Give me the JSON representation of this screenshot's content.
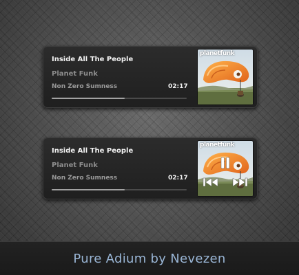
{
  "colors": {
    "panel": "#262626",
    "title_text": "#f2f2f2",
    "secondary_text": "#8d8d8d",
    "progress_fill": "#a3a3a3",
    "footer_text": "#9ab6d6"
  },
  "players": [
    {
      "track_title": "Inside All The People",
      "artist": "Planet Funk",
      "album": "Non Zero Sumness",
      "time": "02:17",
      "progress": 0.54,
      "cover_brand": "planetfunk",
      "controls_visible": false
    },
    {
      "track_title": "Inside All The People",
      "artist": "Planet Funk",
      "album": "Non Zero Sumness",
      "time": "02:17",
      "progress": 0.54,
      "cover_brand": "planetfunk",
      "controls_visible": true,
      "controls": [
        "pause-icon",
        "previous-icon",
        "next-icon"
      ]
    }
  ],
  "footer": {
    "caption": "Pure Adium by Nevezen"
  }
}
